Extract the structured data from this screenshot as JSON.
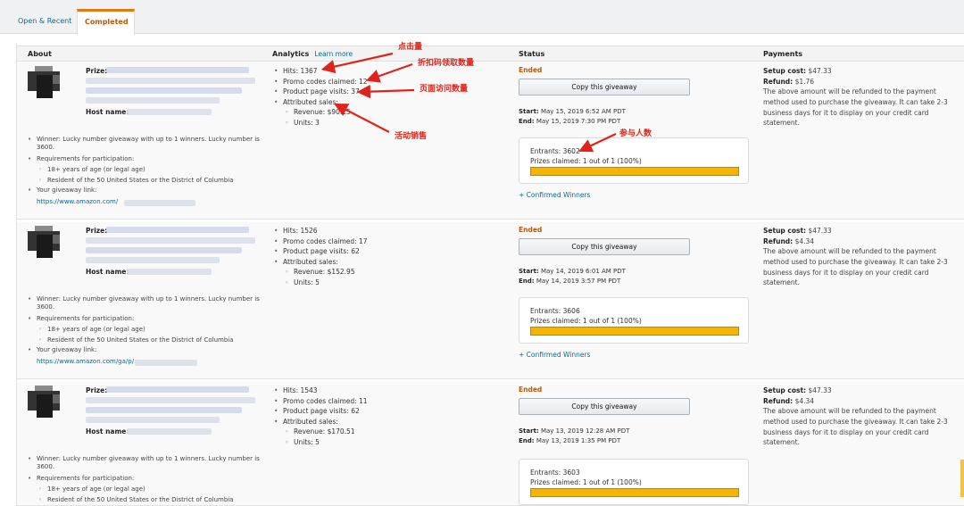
{
  "tabs": [
    {
      "label": "Open & Recent",
      "active": false
    },
    {
      "label": "Completed",
      "active": true
    }
  ],
  "headers": {
    "about": "About",
    "analytics": "Analytics",
    "learn_more": "Learn more",
    "status": "Status",
    "payments": "Payments"
  },
  "annotations": {
    "hits": "点击量",
    "promo": "折扣码领取数量",
    "visits": "页面访问数量",
    "sales": "活动销售",
    "entrants": "参与人数"
  },
  "rows": [
    {
      "prize_label": "Prize:",
      "host_label": "Host name:",
      "winner": "Winner: Lucky number giveaway with up to 1 winners. Lucky number is 3600.",
      "requirements": "Requirements for participation:",
      "req1": "18+ years of age (or legal age)",
      "req2": "Resident of the 50 United States or the District of Columbia",
      "link_label": "Your giveaway link:",
      "link": "https://www.amazon.com/",
      "hits": "Hits: 1367",
      "promo": "Promo codes claimed: 12",
      "visits": "Product page visits: 37",
      "attributed": "Attributed sales:",
      "revenue": "Revenue: $90.15",
      "units": "Units: 3",
      "status": "Ended",
      "copy_button": "Copy this giveaway",
      "start_label": "Start:",
      "start": "May 15, 2019 6:52 AM PDT",
      "end_label": "End:",
      "end": "May 15, 2019 7:30 PM PDT",
      "entrants": "Entrants: 3602",
      "prizes": "Prizes claimed:  1 out of 1 (100%)",
      "progress": 1.0,
      "confirmed": "Confirmed Winners",
      "setup_label": "Setup cost:",
      "setup": "$47.33",
      "refund_label": "Refund:",
      "refund": "$1.76",
      "refund_note": "The above amount will be refunded to the payment method used to purchase the giveaway. It can take 2-3 business days for it to display on your credit card statement."
    },
    {
      "prize_label": "Prize:",
      "host_label": "Host name:",
      "winner": "Winner: Lucky number giveaway with up to 1 winners. Lucky number is 3600.",
      "requirements": "Requirements for participation:",
      "req1": "18+ years of age (or legal age)",
      "req2": "Resident of the 50 United States or the District of Columbia",
      "link_label": "Your giveaway link:",
      "link": "https://www.amazon.com/ga/p/",
      "hits": "Hits: 1526",
      "promo": "Promo codes claimed: 17",
      "visits": "Product page visits: 62",
      "attributed": "Attributed sales:",
      "revenue": "Revenue: $152.95",
      "units": "Units: 5",
      "status": "Ended",
      "copy_button": "Copy this giveaway",
      "start_label": "Start:",
      "start": "May 14, 2019 6:01 AM PDT",
      "end_label": "End:",
      "end": "May 14, 2019 3:57 PM PDT",
      "entrants": "Entrants: 3606",
      "prizes": "Prizes claimed:  1 out of 1 (100%)",
      "progress": 1.0,
      "confirmed": "Confirmed Winners",
      "setup_label": "Setup cost:",
      "setup": "$47.33",
      "refund_label": "Refund:",
      "refund": "$4.34",
      "refund_note": "The above amount will be refunded to the payment method used to purchase the giveaway. It can take 2-3 business days for it to display on your credit card statement."
    },
    {
      "prize_label": "Prize:",
      "host_label": "Host name:",
      "winner": "Winner: Lucky number giveaway with up to 1 winners. Lucky number is 3600.",
      "requirements": "Requirements for participation:",
      "req1": "18+ years of age (or legal age)",
      "req2": "Resident of the 50 United States or the District of Columbia",
      "hits": "Hits: 1543",
      "promo": "Promo codes claimed: 11",
      "visits": "Product page visits: 62",
      "attributed": "Attributed sales:",
      "revenue": "Revenue: $170.51",
      "units": "Units: 5",
      "status": "Ended",
      "copy_button": "Copy this giveaway",
      "start_label": "Start:",
      "start": "May 13, 2019 12:28 AM PDT",
      "end_label": "End:",
      "end": "May 13, 2019 1:35 PM PDT",
      "entrants": "Entrants: 3603",
      "prizes": "Prizes claimed:  1 out of 1 (100%)",
      "progress": 1.0,
      "setup_label": "Setup cost:",
      "setup": "$47.33",
      "refund_label": "Refund:",
      "refund": "$4.34",
      "refund_note": "The above amount will be refunded to the payment method used to purchase the giveaway. It can take 2-3 business days for it to display on your credit card statement."
    }
  ],
  "colors": {
    "accent": "#e47911",
    "ended": "#c45500",
    "link": "#0a6a8f",
    "progress": "#f4b400",
    "annotation": "#e0241b"
  }
}
